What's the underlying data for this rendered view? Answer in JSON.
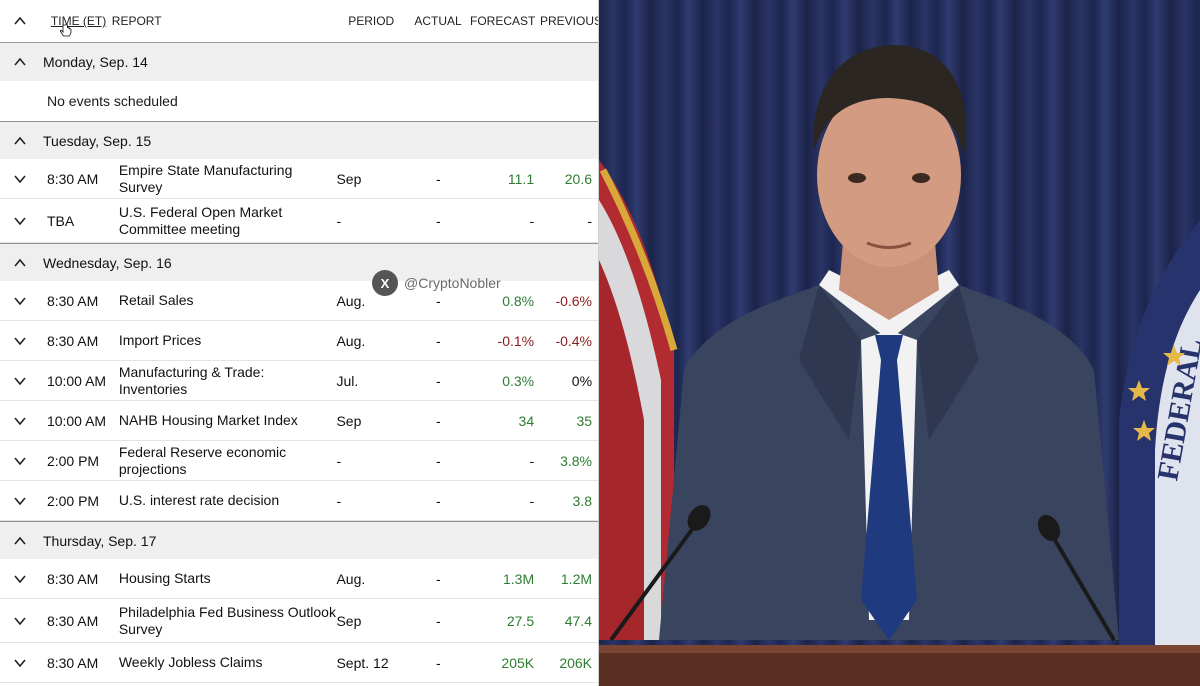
{
  "header": {
    "time": "TIME (ET)",
    "report": "REPORT",
    "period": "PERIOD",
    "actual": "ACTUAL",
    "forecast": "FORECAST",
    "previous": "PREVIOUS"
  },
  "days": [
    {
      "label": "Monday, Sep. 14",
      "empty_text": "No events scheduled",
      "events": []
    },
    {
      "label": "Tuesday, Sep. 15",
      "events": [
        {
          "time": "8:30 AM",
          "report": "Empire State Manufacturing Survey",
          "period": "Sep",
          "actual": "-",
          "forecast": "11.1",
          "forecast_tone": "pos",
          "previous": "20.6",
          "previous_tone": "pos"
        },
        {
          "time": "TBA",
          "report": "U.S. Federal Open Market Committee meeting",
          "period": "-",
          "actual": "-",
          "forecast": "-",
          "forecast_tone": "neu",
          "previous": "-",
          "previous_tone": "neu"
        }
      ]
    },
    {
      "label": "Wednesday, Sep. 16",
      "events": [
        {
          "time": "8:30 AM",
          "report": "Retail Sales",
          "period": "Aug.",
          "actual": "-",
          "forecast": "0.8%",
          "forecast_tone": "pos",
          "previous": "-0.6%",
          "previous_tone": "neg"
        },
        {
          "time": "8:30 AM",
          "report": "Import Prices",
          "period": "Aug.",
          "actual": "-",
          "forecast": "-0.1%",
          "forecast_tone": "neg",
          "previous": "-0.4%",
          "previous_tone": "neg"
        },
        {
          "time": "10:00 AM",
          "report": "Manufacturing & Trade: Inventories",
          "period": "Jul.",
          "actual": "-",
          "forecast": "0.3%",
          "forecast_tone": "pos",
          "previous": "0%",
          "previous_tone": "neu"
        },
        {
          "time": "10:00 AM",
          "report": "NAHB Housing Market Index",
          "period": "Sep",
          "actual": "-",
          "forecast": "34",
          "forecast_tone": "pos",
          "previous": "35",
          "previous_tone": "pos"
        },
        {
          "time": "2:00 PM",
          "report": "Federal Reserve economic projections",
          "period": "-",
          "actual": "-",
          "forecast": "-",
          "forecast_tone": "neu",
          "previous": "3.8%",
          "previous_tone": "pos"
        },
        {
          "time": "2:00 PM",
          "report": "U.S. interest rate decision",
          "period": "-",
          "actual": "-",
          "forecast": "-",
          "forecast_tone": "neu",
          "previous": "3.8",
          "previous_tone": "pos"
        }
      ]
    },
    {
      "label": "Thursday, Sep. 17",
      "events": [
        {
          "time": "8:30 AM",
          "report": "Housing Starts",
          "period": "Aug.",
          "actual": "-",
          "forecast": "1.3M",
          "forecast_tone": "pos",
          "previous": "1.2M",
          "previous_tone": "pos"
        },
        {
          "time": "8:30 AM",
          "report": "Philadelphia Fed Business Outlook Survey",
          "period": "Sep",
          "actual": "-",
          "forecast": "27.5",
          "forecast_tone": "pos",
          "previous": "47.4",
          "previous_tone": "pos"
        },
        {
          "time": "8:30 AM",
          "report": "Weekly Jobless Claims",
          "period": "Sept. 12",
          "actual": "-",
          "forecast": "205K",
          "forecast_tone": "pos",
          "previous": "206K",
          "previous_tone": "pos"
        }
      ]
    }
  ],
  "watermark": {
    "icon": "x-logo-icon",
    "handle": "@CryptoNobler"
  },
  "colors": {
    "positive": "#2e7d32",
    "negative": "#8b1a1a",
    "curtain": "#1f2a55"
  }
}
